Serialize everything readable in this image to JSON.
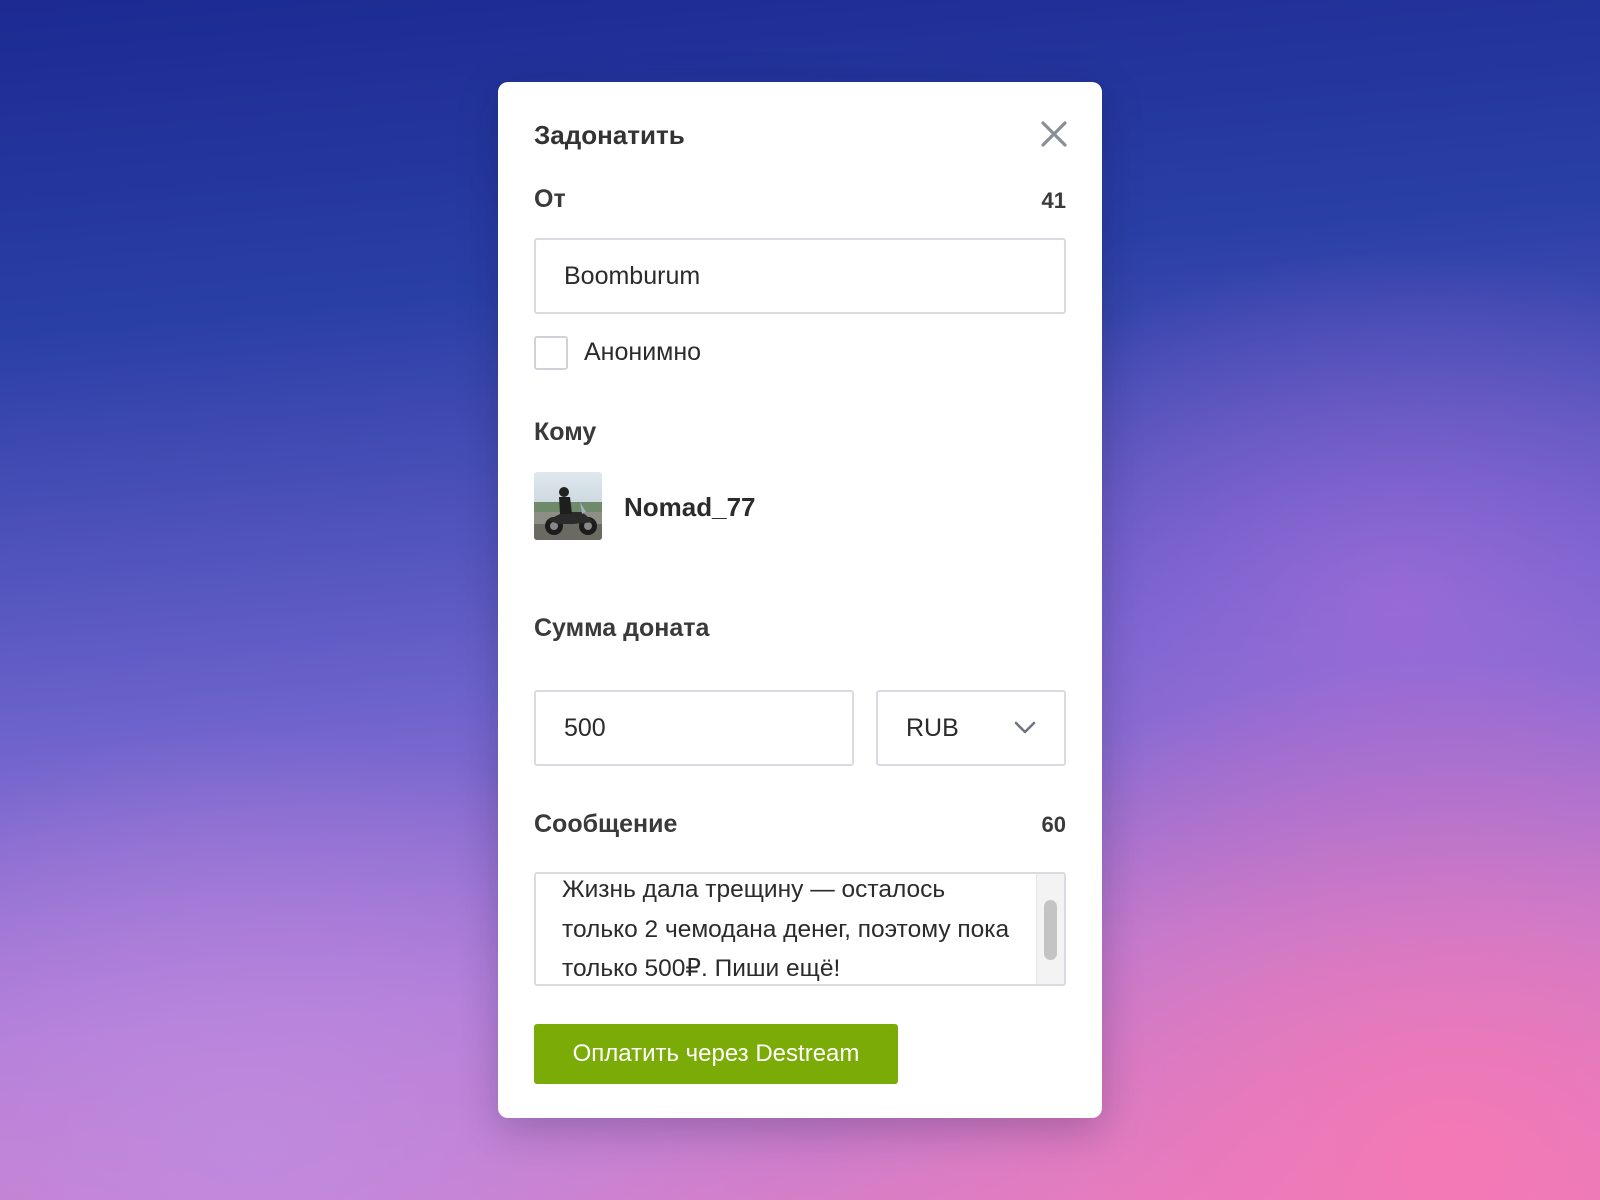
{
  "modal": {
    "title": "Задонатить",
    "close_icon": "close-icon"
  },
  "from": {
    "label": "От",
    "counter": "41",
    "value": "Boomburum",
    "anonymous_label": "Анонимно",
    "anonymous_checked": false
  },
  "to": {
    "label": "Кому",
    "avatar_icon": "avatar-photo",
    "name": "Nomad_77"
  },
  "amount": {
    "label": "Сумма доната",
    "value": "500",
    "currency": "RUB",
    "dropdown_icon": "chevron-down-icon"
  },
  "message": {
    "label": "Сообщение",
    "counter": "60",
    "text": "Жизнь дала трещину — осталось только 2 чемодана денег, поэтому пока только 500₽. Пиши ещё!"
  },
  "pay_button": {
    "label": "Оплатить через Destream",
    "color": "#7bab07"
  },
  "colors": {
    "background_top": "#1c2a92",
    "background_bottom": "#f07ab8",
    "text": "#333333",
    "border": "#d8dbe0"
  }
}
